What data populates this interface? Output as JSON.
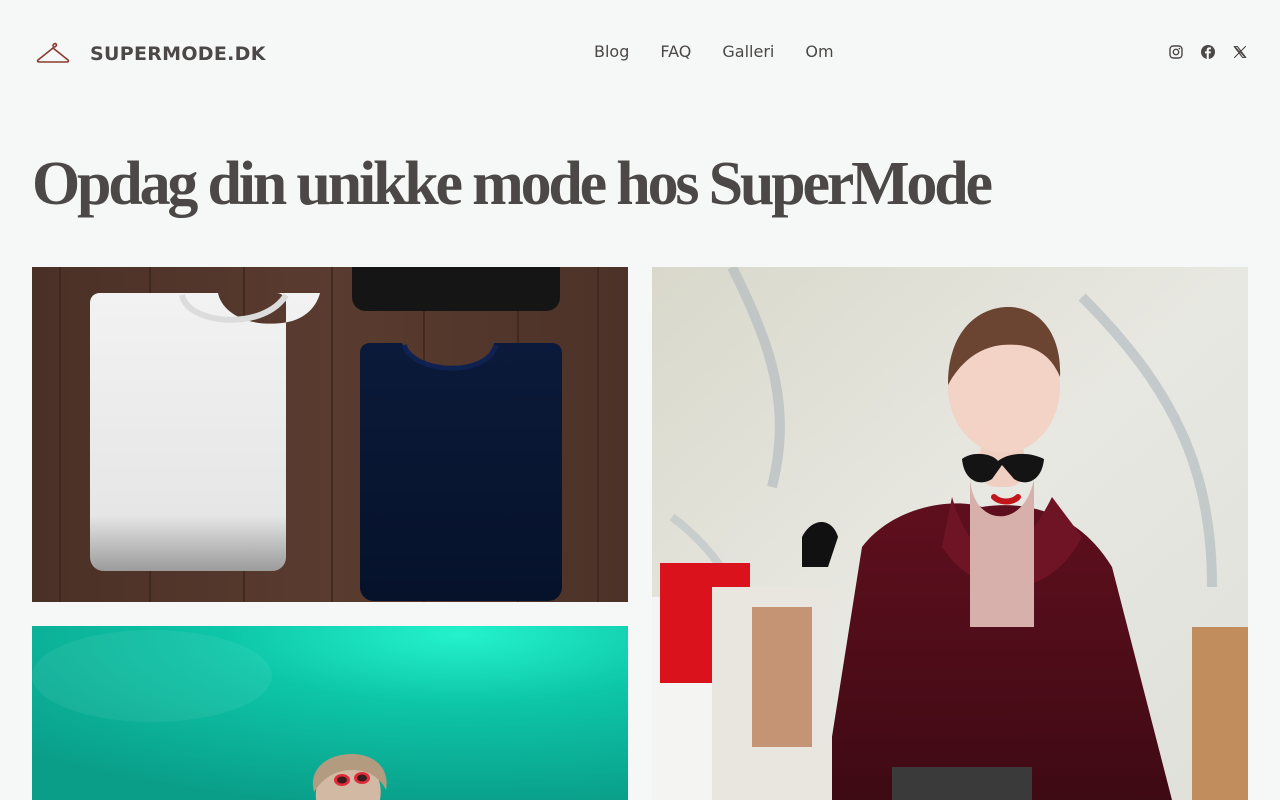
{
  "site": {
    "name": "SUPERMODE.DK",
    "logo_icon": "hanger-icon"
  },
  "nav": {
    "items": [
      {
        "label": "Blog"
      },
      {
        "label": "FAQ"
      },
      {
        "label": "Galleri"
      },
      {
        "label": "Om"
      }
    ]
  },
  "social": {
    "icons": [
      "instagram-icon",
      "facebook-icon",
      "x-icon"
    ]
  },
  "hero": {
    "title": "Opdag din unikke mode hos SuperMode"
  },
  "gallery": {
    "images": [
      {
        "name": "folded-tshirts-image"
      },
      {
        "name": "woman-shopping-bags-image"
      },
      {
        "name": "teal-portrait-image"
      }
    ]
  },
  "colors": {
    "background": "#f6f8f7",
    "text": "#4b4847",
    "logo_accent": "#8a3a2e"
  }
}
